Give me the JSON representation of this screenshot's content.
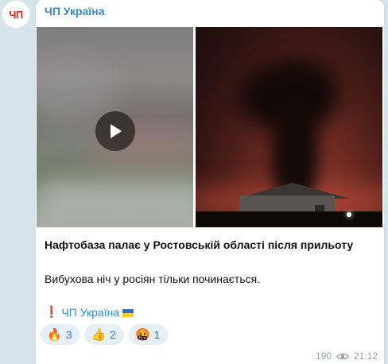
{
  "avatar": {
    "text": "ЧП"
  },
  "channel": {
    "name": "ЧП Україна"
  },
  "post": {
    "headline": "Нафтобаза палає у Ростовській області після прильоту",
    "body": "Вибухова ніч у росіян тільки починається.",
    "signature": {
      "mark": "❗",
      "text": "ЧП Україна"
    }
  },
  "reactions": [
    {
      "emoji": "🔥",
      "count": "3"
    },
    {
      "emoji": "👍",
      "count": "2"
    },
    {
      "emoji": "🤬",
      "count": "1"
    }
  ],
  "meta": {
    "views": "190",
    "time": "21:12"
  },
  "colors": {
    "accent": "#3a8ac4",
    "bubble": "#ffffff",
    "background": "#d5e3ea"
  },
  "icons": {
    "play": "play-icon",
    "views": "eye-icon",
    "flag": "ukraine-flag-icon"
  }
}
